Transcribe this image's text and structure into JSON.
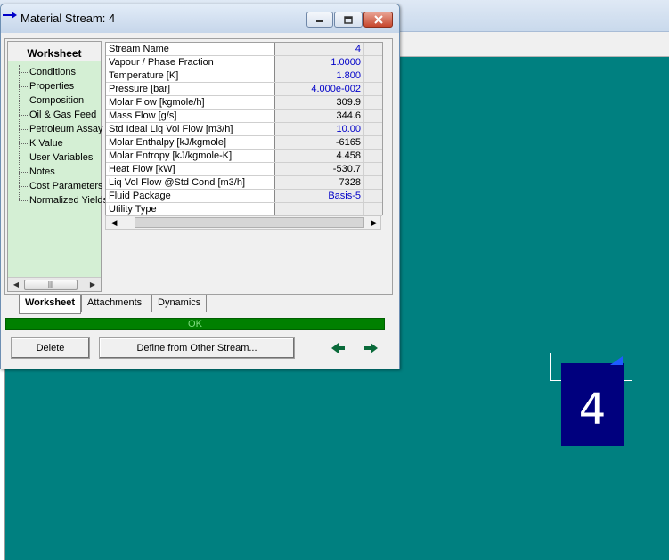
{
  "window": {
    "title": "Material Stream: 4"
  },
  "navigation": {
    "title": "Worksheet",
    "items": [
      "Conditions",
      "Properties",
      "Composition",
      "Oil & Gas Feed",
      "Petroleum Assay",
      "K Value",
      "User Variables",
      "Notes",
      "Cost Parameters",
      "Normalized Yields"
    ]
  },
  "grid": {
    "rows": [
      {
        "name": "Stream Name",
        "value": "4",
        "color": "blue"
      },
      {
        "name": "Vapour / Phase Fraction",
        "value": "1.0000",
        "color": "blue"
      },
      {
        "name": "Temperature [K]",
        "value": "1.800",
        "color": "blue"
      },
      {
        "name": "Pressure [bar]",
        "value": "4.000e-002",
        "color": "blue"
      },
      {
        "name": "Molar Flow [kgmole/h]",
        "value": "309.9",
        "color": "black"
      },
      {
        "name": "Mass Flow [g/s]",
        "value": "344.6",
        "color": "black"
      },
      {
        "name": "Std Ideal Liq Vol Flow [m3/h]",
        "value": "10.00",
        "color": "blue"
      },
      {
        "name": "Molar Enthalpy [kJ/kgmole]",
        "value": "-6165",
        "color": "black"
      },
      {
        "name": "Molar Entropy [kJ/kgmole-K]",
        "value": "4.458",
        "color": "black"
      },
      {
        "name": "Heat Flow [kW]",
        "value": "-530.7",
        "color": "black"
      },
      {
        "name": "Liq Vol Flow @Std Cond [m3/h]",
        "value": "7328",
        "color": "black"
      },
      {
        "name": "Fluid Package",
        "value": "Basis-5",
        "color": "blue"
      },
      {
        "name": "Utility Type",
        "value": "",
        "color": "black"
      }
    ]
  },
  "tabs": [
    "Worksheet",
    "Attachments",
    "Dynamics"
  ],
  "status": {
    "text": "OK",
    "color": "#008000"
  },
  "buttons": {
    "delete": "Delete",
    "define": "Define from Other Stream..."
  },
  "canvas": {
    "stream_label": "4",
    "background": "#008080"
  }
}
